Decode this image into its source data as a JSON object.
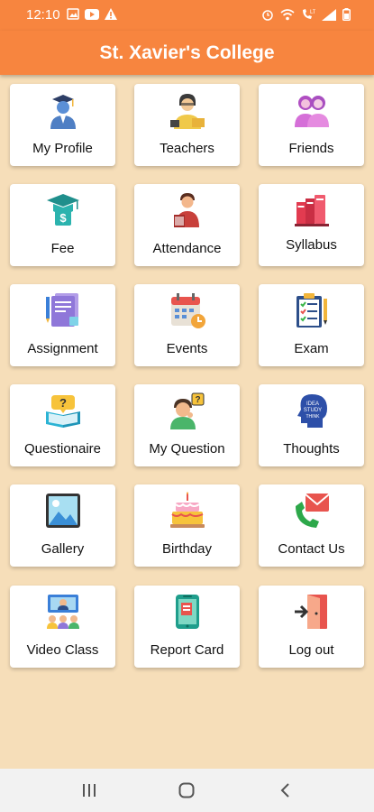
{
  "status_bar": {
    "time": "12:10",
    "left_icons": [
      "image-icon",
      "youtube-icon",
      "warning-icon"
    ],
    "right_icons": [
      "alarm-icon",
      "wifi-icon",
      "call-icon",
      "signal-icon",
      "battery-icon"
    ]
  },
  "app_bar": {
    "title": "St. Xavier's College",
    "color": "#f7853f"
  },
  "tiles": [
    {
      "label": "My Profile",
      "icon": "graduate-profile-icon"
    },
    {
      "label": "Teachers",
      "icon": "teacher-icon"
    },
    {
      "label": "Friends",
      "icon": "friends-icon"
    },
    {
      "label": "Fee",
      "icon": "graduation-fee-icon"
    },
    {
      "label": "Attendance",
      "icon": "attendance-icon"
    },
    {
      "label": "Syllabus",
      "icon": "books-icon"
    },
    {
      "label": "Assignment",
      "icon": "assignment-icon"
    },
    {
      "label": "Events",
      "icon": "calendar-icon"
    },
    {
      "label": "Exam",
      "icon": "checklist-icon"
    },
    {
      "label": "Questionaire",
      "icon": "question-book-icon"
    },
    {
      "label": "My Question",
      "icon": "thinking-person-icon"
    },
    {
      "label": "Thoughts",
      "icon": "head-thoughts-icon"
    },
    {
      "label": "Gallery",
      "icon": "gallery-icon"
    },
    {
      "label": "Birthday",
      "icon": "cake-icon"
    },
    {
      "label": "Contact Us",
      "icon": "contact-icon"
    },
    {
      "label": "Video Class",
      "icon": "video-class-icon"
    },
    {
      "label": "Report Card",
      "icon": "report-card-icon"
    },
    {
      "label": "Log out",
      "icon": "logout-door-icon"
    }
  ],
  "nav_bar": {
    "buttons": [
      "recent-apps-icon",
      "home-icon",
      "back-icon"
    ]
  },
  "background_color": "#f6deb9"
}
